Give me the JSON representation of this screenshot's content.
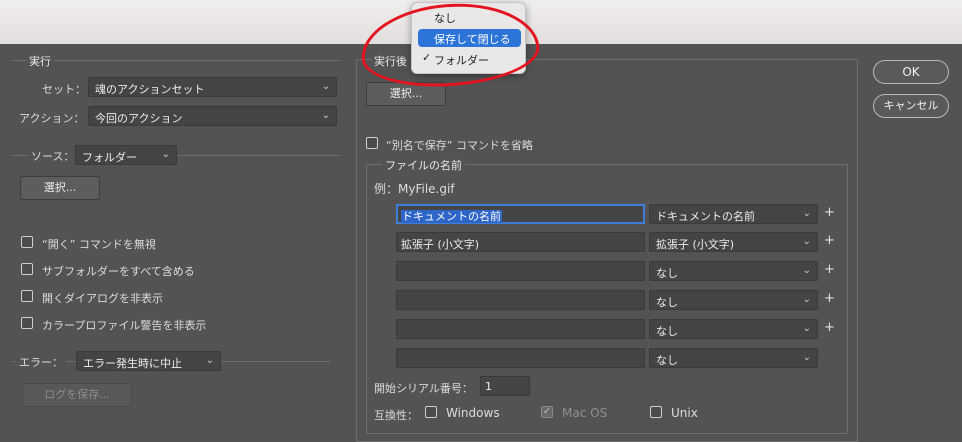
{
  "run_section": {
    "title": "実行",
    "set_label": "セット：",
    "set_value": "魂のアクションセット",
    "action_label": "アクション：",
    "action_value": "今回のアクション"
  },
  "source_section": {
    "label": "ソース：",
    "value": "フォルダー",
    "choose_button": "選択...",
    "options": [
      "“開く” コマンドを無視",
      "サブフォルダーをすべて含める",
      "開くダイアログを非表示",
      "カラープロファイル警告を非表示"
    ]
  },
  "error_section": {
    "label": "エラー：",
    "value": "エラー発生時に中止",
    "save_log_button": "ログを保存..."
  },
  "after_section": {
    "title": "実行後",
    "choose_button": "選択...",
    "override_save_as": "“別名で保存” コマンドを省略"
  },
  "popup_menu": {
    "items": [
      "なし",
      "保存して閉じる",
      "フォルダー"
    ],
    "selected_index": 1,
    "checked_index": 2
  },
  "file_naming": {
    "title": "ファイルの名前",
    "example_label": "例：MyFile.gif",
    "rows": [
      {
        "text": "ドキュメントの名前",
        "select": "ドキュメントの名前",
        "plus": "+"
      },
      {
        "text": "拡張子 (小文字)",
        "select": "拡張子 (小文字)",
        "plus": "+"
      },
      {
        "text": "",
        "select": "なし",
        "plus": "+"
      },
      {
        "text": "",
        "select": "なし",
        "plus": "+"
      },
      {
        "text": "",
        "select": "なし",
        "plus": "+"
      },
      {
        "text": "",
        "select": "なし",
        "plus": ""
      }
    ],
    "serial_label": "開始シリアル番号：",
    "serial_value": "1",
    "compat_label": "互換性：",
    "compat_windows": "Windows",
    "compat_macos": "Mac OS",
    "compat_unix": "Unix"
  },
  "buttons": {
    "ok": "OK",
    "cancel": "キャンセル"
  },
  "icons": {
    "chevron": "⌄",
    "check": "✓"
  },
  "colors": {
    "dialog_bg": "#535353",
    "accent": "#2d74d9",
    "annotation_red": "#e3141f"
  }
}
